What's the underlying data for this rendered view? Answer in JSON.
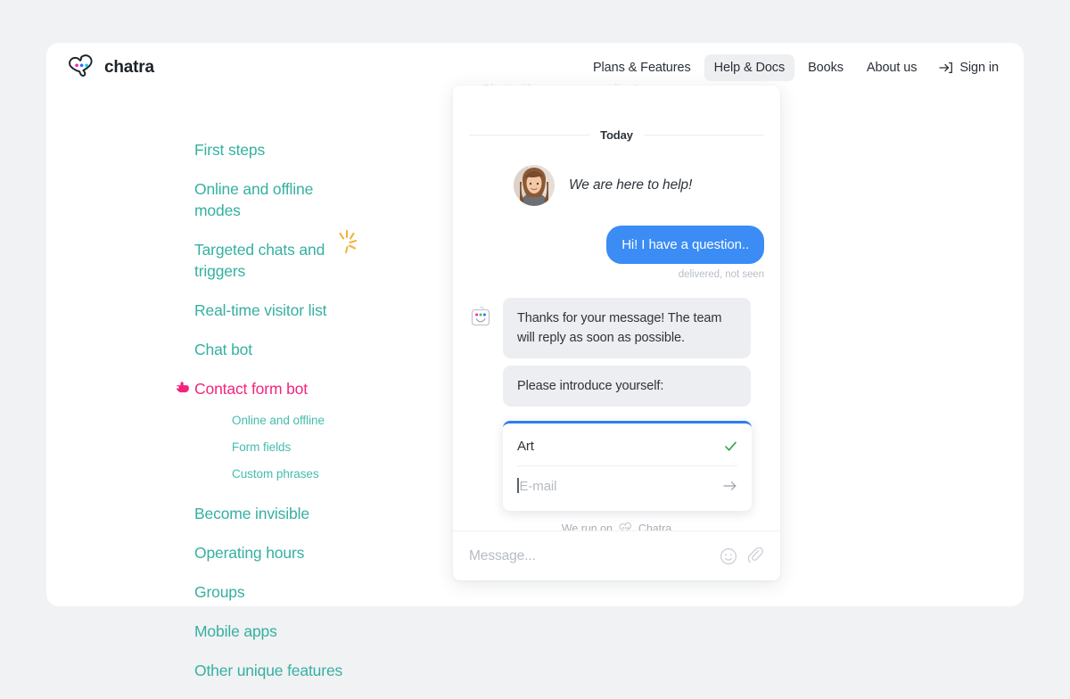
{
  "brand": {
    "name": "chatra",
    "logo_icon": "chat-bubble-dots-logo"
  },
  "topnav": {
    "links": [
      {
        "label": "Plans & Features",
        "active": false
      },
      {
        "label": "Help & Docs",
        "active": true
      },
      {
        "label": "Books",
        "active": false
      },
      {
        "label": "About us",
        "active": false
      }
    ],
    "signin": {
      "label": "Sign in",
      "icon": "sign-in-arrow-icon"
    }
  },
  "docs_nav": {
    "items": [
      {
        "label": "First steps"
      },
      {
        "label": "Online and offline modes"
      },
      {
        "label": "Targeted chats and triggers",
        "decoration": "sparkle-icon"
      },
      {
        "label": "Real-time visitor list"
      },
      {
        "label": "Chat bot"
      },
      {
        "label": "Contact form bot",
        "current": true,
        "icon": "pointing-hand-icon"
      },
      {
        "label": "Become invisible"
      },
      {
        "label": "Operating hours"
      },
      {
        "label": "Groups"
      },
      {
        "label": "Mobile apps"
      },
      {
        "label": "Other unique features"
      }
    ],
    "sub_items": [
      {
        "label": "Online and offline"
      },
      {
        "label": "Form fields"
      },
      {
        "label": "Custom phrases"
      }
    ]
  },
  "chat_widget": {
    "header": {
      "status_text": "Chat with us, we are online!",
      "status_dot": "online-status-dot",
      "close_label": "×"
    },
    "day_divider": "Today",
    "agent_message": {
      "text": "We are here to help!",
      "avatar": "agent-photo-avatar"
    },
    "user_message": {
      "text": "Hi! I have a question..",
      "status": "delivered, not seen"
    },
    "bot_avatar": "robot-face-icon",
    "bot_messages": [
      "Thanks for your message! The team will reply as soon as possible.",
      "Please introduce yourself:"
    ],
    "form": {
      "name_value": "Art",
      "name_check_icon": "green-check-icon",
      "email_placeholder": "E-mail",
      "submit_icon": "right-arrow-icon"
    },
    "footer": {
      "prefix": "We run on",
      "brand": "Chatra",
      "icon": "chat-bubble-dots-icon"
    },
    "composer": {
      "placeholder": "Message...",
      "emoji_icon": "smiley-icon",
      "attach_icon": "paperclip-icon"
    }
  },
  "colors": {
    "accent_teal": "#35b0a0",
    "accent_pink": "#f4247c",
    "user_bubble_blue": "#3b8cf5",
    "form_top_blue": "#2b7fef",
    "check_green": "#2aa84a",
    "sparkle_orange": "#f5b23c",
    "page_background": "#f1f2f4"
  }
}
